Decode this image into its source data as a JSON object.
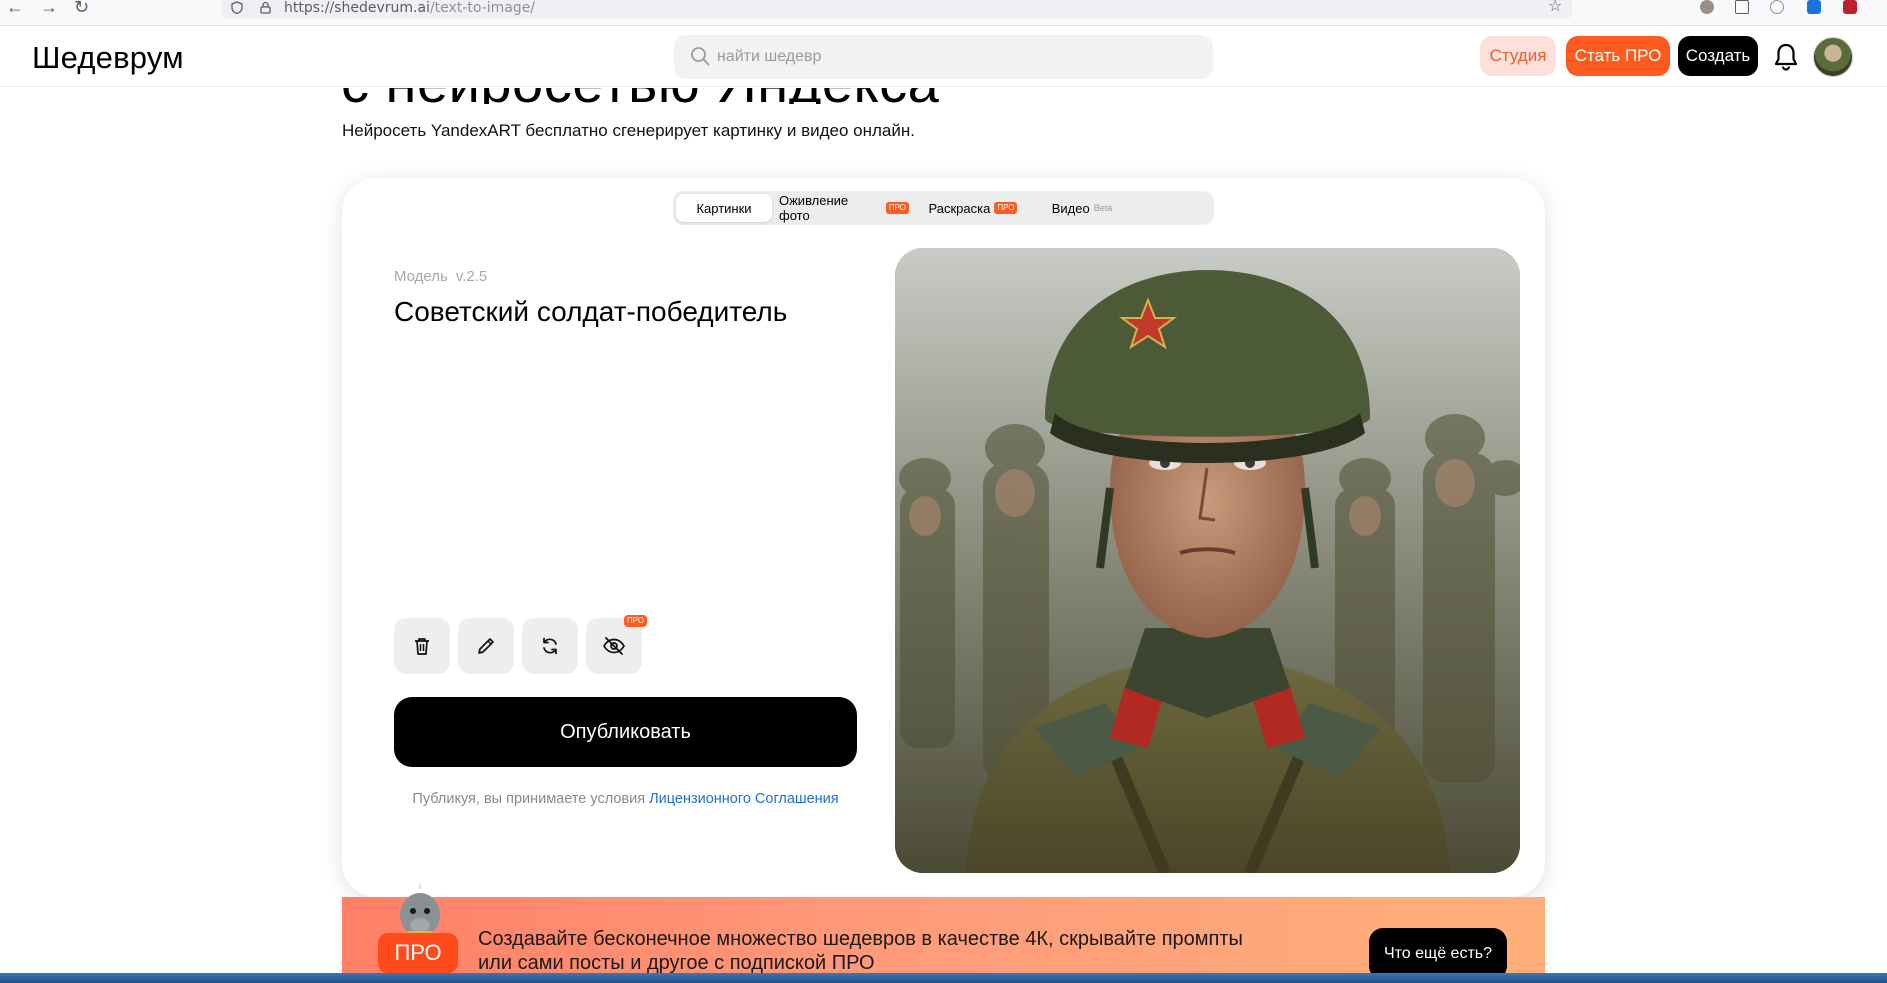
{
  "browser": {
    "url_host": "https://shedevrum.ai",
    "url_path": "/text-to-image/"
  },
  "header": {
    "logo": "Шедеврум",
    "search_placeholder": "найти шедевр",
    "studio_label": "Студия",
    "pro_label": "Стать ПРО",
    "create_label": "Создать"
  },
  "page": {
    "headline": "с нейросетью Яндекса",
    "subtitle": "Нейросеть YandexART бесплатно сгенерирует картинку и видео онлайн."
  },
  "tabs": [
    {
      "label": "Картинки",
      "active": true
    },
    {
      "label": "Оживление фото",
      "badge": "ПРО"
    },
    {
      "label": "Раскраска",
      "badge": "ПРО"
    },
    {
      "label": "Видео",
      "note": "Beta"
    }
  ],
  "editor": {
    "model_label": "Модель",
    "model_version": "v.2.5",
    "prompt": "Советский солдат-победитель",
    "tools": [
      "trash-icon",
      "pencil-icon",
      "refresh-icon",
      "eye-off-icon"
    ],
    "hide_badge": "ПРО",
    "publish_label": "Опубликовать",
    "terms_prefix": "Публикуя, вы принимаете условия ",
    "terms_link": "Лицензионного Соглашения"
  },
  "promo": {
    "pro_badge": "ПРО",
    "text": "Создавайте бесконечное множество шедевров в качестве 4К, скрывайте промпты или сами посты и другое с подпиской ПРО",
    "button": "Что ещё есть?"
  },
  "colors": {
    "accent_orange": "#ff5a1f",
    "studio_bg": "#fde0da",
    "link_blue": "#1f6fd1"
  }
}
